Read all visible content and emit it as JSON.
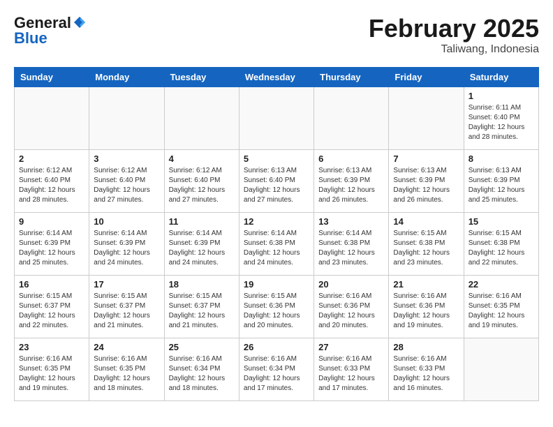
{
  "header": {
    "logo_line1": "General",
    "logo_line2": "Blue",
    "month_year": "February 2025",
    "location": "Taliwang, Indonesia"
  },
  "days_of_week": [
    "Sunday",
    "Monday",
    "Tuesday",
    "Wednesday",
    "Thursday",
    "Friday",
    "Saturday"
  ],
  "weeks": [
    [
      {
        "day": "",
        "info": ""
      },
      {
        "day": "",
        "info": ""
      },
      {
        "day": "",
        "info": ""
      },
      {
        "day": "",
        "info": ""
      },
      {
        "day": "",
        "info": ""
      },
      {
        "day": "",
        "info": ""
      },
      {
        "day": "1",
        "info": "Sunrise: 6:11 AM\nSunset: 6:40 PM\nDaylight: 12 hours and 28 minutes."
      }
    ],
    [
      {
        "day": "2",
        "info": "Sunrise: 6:12 AM\nSunset: 6:40 PM\nDaylight: 12 hours and 28 minutes."
      },
      {
        "day": "3",
        "info": "Sunrise: 6:12 AM\nSunset: 6:40 PM\nDaylight: 12 hours and 27 minutes."
      },
      {
        "day": "4",
        "info": "Sunrise: 6:12 AM\nSunset: 6:40 PM\nDaylight: 12 hours and 27 minutes."
      },
      {
        "day": "5",
        "info": "Sunrise: 6:13 AM\nSunset: 6:40 PM\nDaylight: 12 hours and 27 minutes."
      },
      {
        "day": "6",
        "info": "Sunrise: 6:13 AM\nSunset: 6:39 PM\nDaylight: 12 hours and 26 minutes."
      },
      {
        "day": "7",
        "info": "Sunrise: 6:13 AM\nSunset: 6:39 PM\nDaylight: 12 hours and 26 minutes."
      },
      {
        "day": "8",
        "info": "Sunrise: 6:13 AM\nSunset: 6:39 PM\nDaylight: 12 hours and 25 minutes."
      }
    ],
    [
      {
        "day": "9",
        "info": "Sunrise: 6:14 AM\nSunset: 6:39 PM\nDaylight: 12 hours and 25 minutes."
      },
      {
        "day": "10",
        "info": "Sunrise: 6:14 AM\nSunset: 6:39 PM\nDaylight: 12 hours and 24 minutes."
      },
      {
        "day": "11",
        "info": "Sunrise: 6:14 AM\nSunset: 6:39 PM\nDaylight: 12 hours and 24 minutes."
      },
      {
        "day": "12",
        "info": "Sunrise: 6:14 AM\nSunset: 6:38 PM\nDaylight: 12 hours and 24 minutes."
      },
      {
        "day": "13",
        "info": "Sunrise: 6:14 AM\nSunset: 6:38 PM\nDaylight: 12 hours and 23 minutes."
      },
      {
        "day": "14",
        "info": "Sunrise: 6:15 AM\nSunset: 6:38 PM\nDaylight: 12 hours and 23 minutes."
      },
      {
        "day": "15",
        "info": "Sunrise: 6:15 AM\nSunset: 6:38 PM\nDaylight: 12 hours and 22 minutes."
      }
    ],
    [
      {
        "day": "16",
        "info": "Sunrise: 6:15 AM\nSunset: 6:37 PM\nDaylight: 12 hours and 22 minutes."
      },
      {
        "day": "17",
        "info": "Sunrise: 6:15 AM\nSunset: 6:37 PM\nDaylight: 12 hours and 21 minutes."
      },
      {
        "day": "18",
        "info": "Sunrise: 6:15 AM\nSunset: 6:37 PM\nDaylight: 12 hours and 21 minutes."
      },
      {
        "day": "19",
        "info": "Sunrise: 6:15 AM\nSunset: 6:36 PM\nDaylight: 12 hours and 20 minutes."
      },
      {
        "day": "20",
        "info": "Sunrise: 6:16 AM\nSunset: 6:36 PM\nDaylight: 12 hours and 20 minutes."
      },
      {
        "day": "21",
        "info": "Sunrise: 6:16 AM\nSunset: 6:36 PM\nDaylight: 12 hours and 19 minutes."
      },
      {
        "day": "22",
        "info": "Sunrise: 6:16 AM\nSunset: 6:35 PM\nDaylight: 12 hours and 19 minutes."
      }
    ],
    [
      {
        "day": "23",
        "info": "Sunrise: 6:16 AM\nSunset: 6:35 PM\nDaylight: 12 hours and 19 minutes."
      },
      {
        "day": "24",
        "info": "Sunrise: 6:16 AM\nSunset: 6:35 PM\nDaylight: 12 hours and 18 minutes."
      },
      {
        "day": "25",
        "info": "Sunrise: 6:16 AM\nSunset: 6:34 PM\nDaylight: 12 hours and 18 minutes."
      },
      {
        "day": "26",
        "info": "Sunrise: 6:16 AM\nSunset: 6:34 PM\nDaylight: 12 hours and 17 minutes."
      },
      {
        "day": "27",
        "info": "Sunrise: 6:16 AM\nSunset: 6:33 PM\nDaylight: 12 hours and 17 minutes."
      },
      {
        "day": "28",
        "info": "Sunrise: 6:16 AM\nSunset: 6:33 PM\nDaylight: 12 hours and 16 minutes."
      },
      {
        "day": "",
        "info": ""
      }
    ]
  ]
}
